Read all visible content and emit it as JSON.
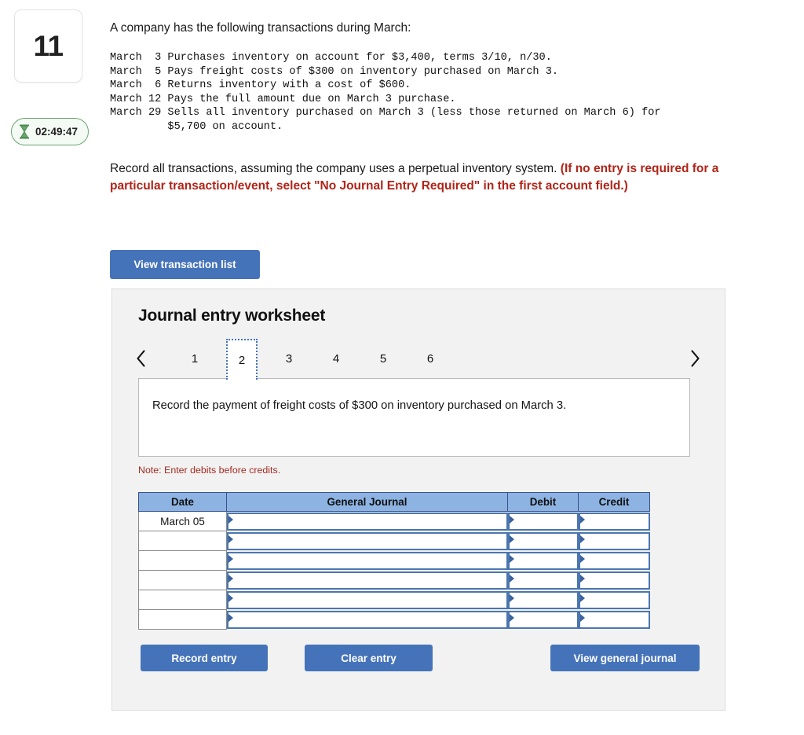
{
  "question": {
    "number": "11",
    "timer": "02:49:47",
    "timer_icon": "hourglass-icon"
  },
  "intro": "A company has the following transactions during March:",
  "transactions_text": "March  3 Purchases inventory on account for $3,400, terms 3/10, n/30.\nMarch  5 Pays freight costs of $300 on inventory purchased on March 3.\nMarch  6 Returns inventory with a cost of $600.\nMarch 12 Pays the full amount due on March 3 purchase.\nMarch 29 Sells all inventory purchased on March 3 (less those returned on March 6) for\n         $5,700 on account.",
  "instruction": {
    "black_part": "Record all transactions, assuming the company uses a perpetual inventory system. ",
    "red_part": "(If no entry is required for a particular transaction/event, select \"No Journal Entry Required\" in the first account field.)"
  },
  "toolbar": {
    "view_transaction_list_label": "View transaction list"
  },
  "worksheet": {
    "title": "Journal entry worksheet",
    "prev_icon": "chevron-left-icon",
    "next_icon": "chevron-right-icon",
    "tabs": [
      {
        "label": "1",
        "active": false
      },
      {
        "label": "2",
        "active": true
      },
      {
        "label": "3",
        "active": false
      },
      {
        "label": "4",
        "active": false
      },
      {
        "label": "5",
        "active": false
      },
      {
        "label": "6",
        "active": false
      }
    ],
    "prompt": "Record the payment of freight costs of $300 on inventory purchased on March 3.",
    "note": "Note: Enter debits before credits.",
    "table": {
      "headers": [
        "Date",
        "General Journal",
        "Debit",
        "Credit"
      ],
      "rows": [
        {
          "date": "March 05",
          "general_journal": "",
          "debit": "",
          "credit": ""
        },
        {
          "date": "",
          "general_journal": "",
          "debit": "",
          "credit": ""
        },
        {
          "date": "",
          "general_journal": "",
          "debit": "",
          "credit": ""
        },
        {
          "date": "",
          "general_journal": "",
          "debit": "",
          "credit": ""
        },
        {
          "date": "",
          "general_journal": "",
          "debit": "",
          "credit": ""
        },
        {
          "date": "",
          "general_journal": "",
          "debit": "",
          "credit": ""
        }
      ]
    },
    "buttons": {
      "record_entry": "Record entry",
      "clear_entry": "Clear entry",
      "view_general_journal": "View general journal"
    }
  },
  "colors": {
    "button_blue": "#4573ba",
    "table_header_blue": "#8db3e2",
    "input_border_blue": "#4b76b0",
    "tab_active_border": "#4472b8",
    "red_text": "#b02418",
    "note_red": "#a32b20",
    "timer_green": "#6aa76e",
    "panel_bg": "#f2f2f2"
  }
}
